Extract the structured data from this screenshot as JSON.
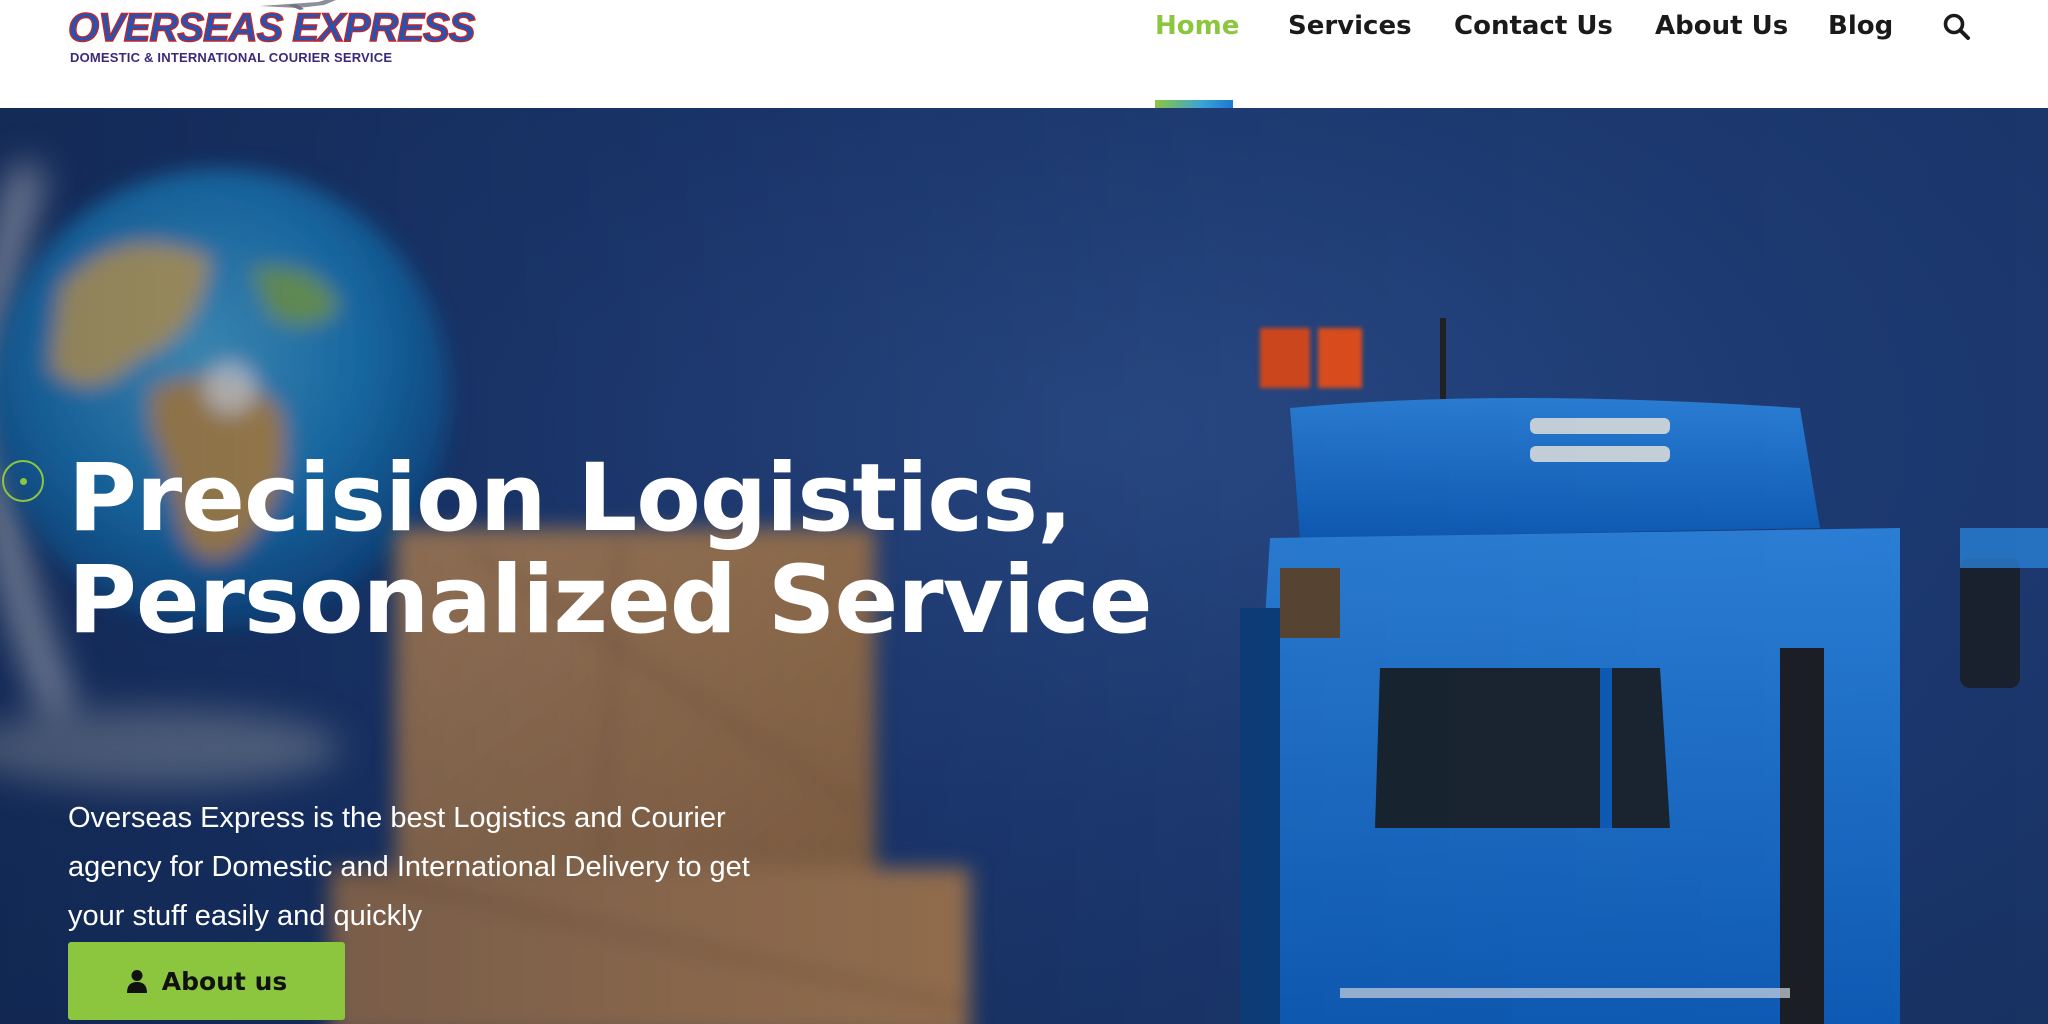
{
  "brand": {
    "name": "OVERSEAS EXPRESS",
    "tagline": "DOMESTIC & INTERNATIONAL COURIER SERVICE",
    "colors": {
      "primary": "#1f55b8",
      "outline": "#c0262a",
      "tagline": "#3b2a7a"
    }
  },
  "nav": {
    "items": [
      {
        "label": "Home",
        "active": true
      },
      {
        "label": "Services",
        "active": false
      },
      {
        "label": "Contact Us",
        "active": false
      },
      {
        "label": "About Us",
        "active": false
      },
      {
        "label": "Blog",
        "active": false
      }
    ],
    "search_icon": "search-icon",
    "active_color": "#8cc63f"
  },
  "hero": {
    "title_line1": "Precision Logistics,",
    "title_line2": "Personalized Service",
    "description": "Overseas Express is the best Logistics and Courier agency for Domestic and International Delivery to get your stuff easily and quickly",
    "button": {
      "label": "About us",
      "icon": "user-icon",
      "color": "#8cc63f"
    },
    "background_color": "#1d3a72"
  }
}
